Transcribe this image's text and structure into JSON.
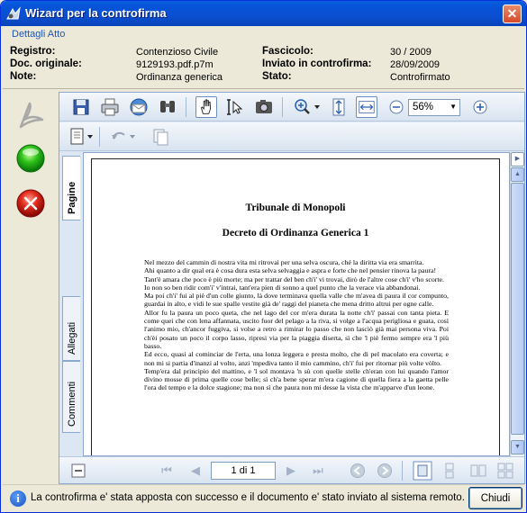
{
  "window": {
    "title": "Wizard per la controfirma",
    "close_glyph": "✕"
  },
  "details": {
    "legend": "Dettagli Atto",
    "registro_label": "Registro:",
    "registro_value": "Contenzioso Civile",
    "doc_label": "Doc. originale:",
    "doc_value": "9129193.pdf.p7m",
    "note_label": "Note:",
    "note_value": "Ordinanza generica",
    "fascicolo_label": "Fascicolo:",
    "fascicolo_value": "30 / 2009",
    "inviato_label": "Inviato in controfirma:",
    "inviato_value": "28/09/2009",
    "stato_label": "Stato:",
    "stato_value": "Controfirmato"
  },
  "actions": [
    {
      "name": "acrobat-sign-icon"
    },
    {
      "name": "green-ok-icon"
    },
    {
      "name": "red-cancel-icon"
    }
  ],
  "viewer": {
    "zoom": "56%",
    "tabs": {
      "pagine": "Pagine",
      "allegati": "Allegati",
      "commenti": "Commenti"
    },
    "page_indicator": "1 di 1"
  },
  "document": {
    "title1": "Tribunale di Monopoli",
    "title2": "Decreto di Ordinanza Generica 1",
    "paragraphs": [
      "Nel mezzo del cammin di nostra vita mi ritrovai per una selva oscura, ché la diritta via era smarrita.",
      "Ahi quanto a dir qual era è cosa dura esta selva selvaggia e aspra e forte che nel pensier rinova la paura!",
      "Tant'è amara che poco è più morte; ma per trattar del ben ch'i' vi trovai, dirò de l'altre cose ch'i' v'ho scorte.",
      "Io non so ben ridir com'i' v'intrai, tant'era pien di sonno a quel punto che la verace via abbandonai.",
      "Ma poi ch'i' fui al piè d'un colle giunto, là dove terminava quella valle che m'avea di paura il cor compunto, guardai in alto, e vidi le sue spalle vestite già de' raggi del pianeta che mena dritto altrui per ogne calle.",
      "Allor fu la paura un poco queta, che nel lago del cor m'era durata la notte ch'i' passai con tanta pieta. E come quei che con lena affannata, uscito fuor del pelago a la riva, si volge a l'acqua perigliosa e guata, così l'animo mio, ch'ancor fuggiva, si volse a retro a rimirar lo passo che non lasciò già mai persona viva. Poi ch'èi posato un poco il corpo lasso, ripresi via per la piaggia diserta, sì che 'l piè fermo sempre era 'l più basso.",
      "Ed ecco, quasi al cominciar de l'erta, una lonza leggera e presta molto, che di pel macolato era coverta; e non mi si partia d'inanzi al volto, anzi 'mpediva tanto il mio cammino, ch'i' fui per ritornar più volte vòlto.",
      "Temp'era dal principio del mattino, e 'l sol montava 'n sù con quelle stelle ch'eran con lui quando l'amor divino mosse di prima quelle cose belle; sì ch'a bene sperar m'era cagione di quella fiera a la gaetta pelle l'ora del tempo e la dolce stagione; ma non sì che paura non mi desse la vista che m'apparve d'un leone."
    ]
  },
  "status": {
    "message": "La controfirma e' stata apposta con successo e il documento e' stato inviato al sistema remoto.",
    "close_label": "Chiudi"
  }
}
